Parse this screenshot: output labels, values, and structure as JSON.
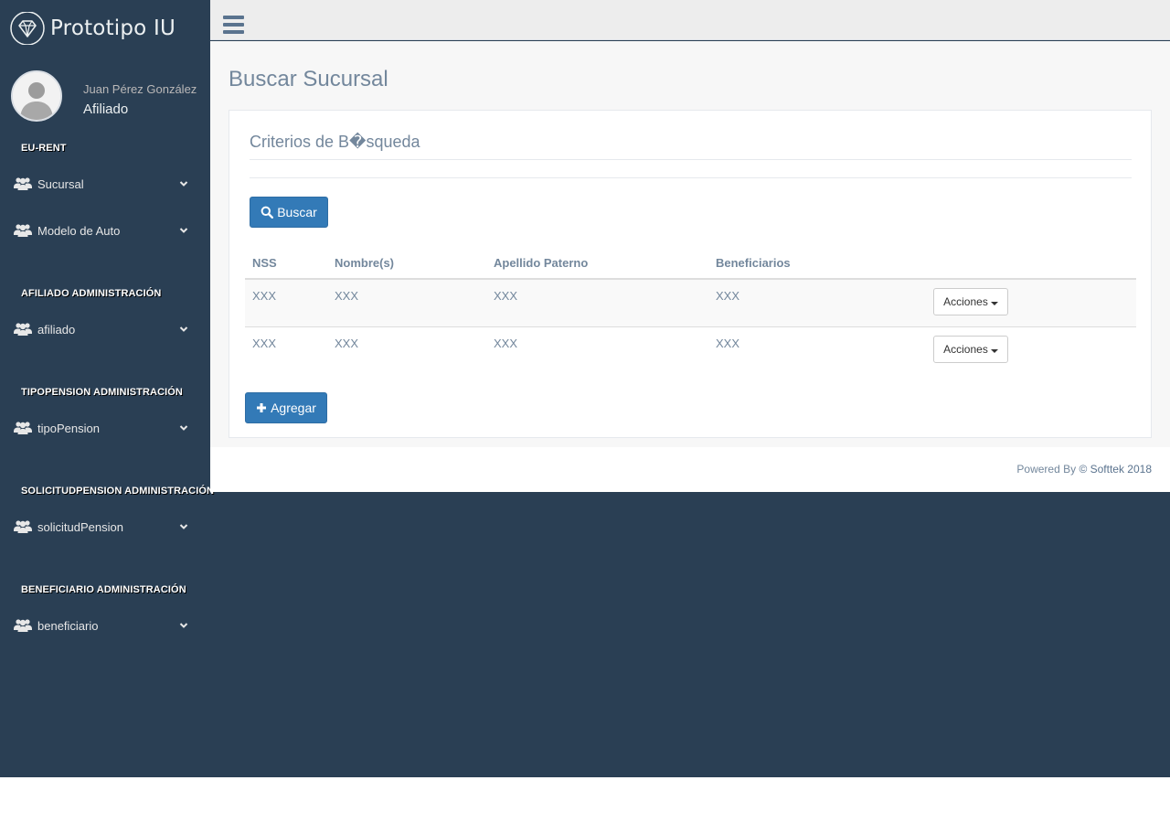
{
  "brand": {
    "title": "Prototipo IU",
    "icon": "diamond-icon"
  },
  "profile": {
    "name": "Juan Pérez González",
    "role": "Afiliado"
  },
  "sidebar": {
    "sections": [
      {
        "title": "EU-RENT",
        "items": [
          {
            "label": "Sucursal",
            "icon": "users-icon"
          },
          {
            "label": "Modelo de Auto",
            "icon": "users-icon"
          }
        ]
      },
      {
        "title": "AFILIADO ADMINISTRACIÓN",
        "items": [
          {
            "label": "afiliado",
            "icon": "users-icon"
          }
        ]
      },
      {
        "title": "TIPOPENSION ADMINISTRACIÓN",
        "items": [
          {
            "label": "tipoPension",
            "icon": "users-icon"
          }
        ]
      },
      {
        "title": "SOLICITUDPENSION ADMINISTRACIÓN",
        "items": [
          {
            "label": "solicitudPension",
            "icon": "users-icon"
          }
        ]
      },
      {
        "title": "BENEFICIARIO ADMINISTRACIÓN",
        "items": [
          {
            "label": "beneficiario",
            "icon": "users-icon"
          }
        ]
      }
    ]
  },
  "main": {
    "title": "Buscar Sucursal",
    "panel_title": "Criterios de B�squeda",
    "search_button": "Buscar",
    "add_button": "Agregar",
    "table": {
      "headers": [
        "NSS",
        "Nombre(s)",
        "Apellido Paterno",
        "Beneficiarios"
      ],
      "rows": [
        {
          "cells": [
            "XXX",
            "XXX",
            "XXX",
            "XXX"
          ],
          "action": "Acciones"
        },
        {
          "cells": [
            "XXX",
            "XXX",
            "XXX",
            "XXX"
          ],
          "action": "Acciones"
        }
      ]
    }
  },
  "footer": {
    "prefix": "Powered By",
    "brand": "© Softtek 2018"
  },
  "colors": {
    "sidebar_bg": "#2a3f54",
    "primary": "#337ab7",
    "text_muted": "#73879c"
  }
}
